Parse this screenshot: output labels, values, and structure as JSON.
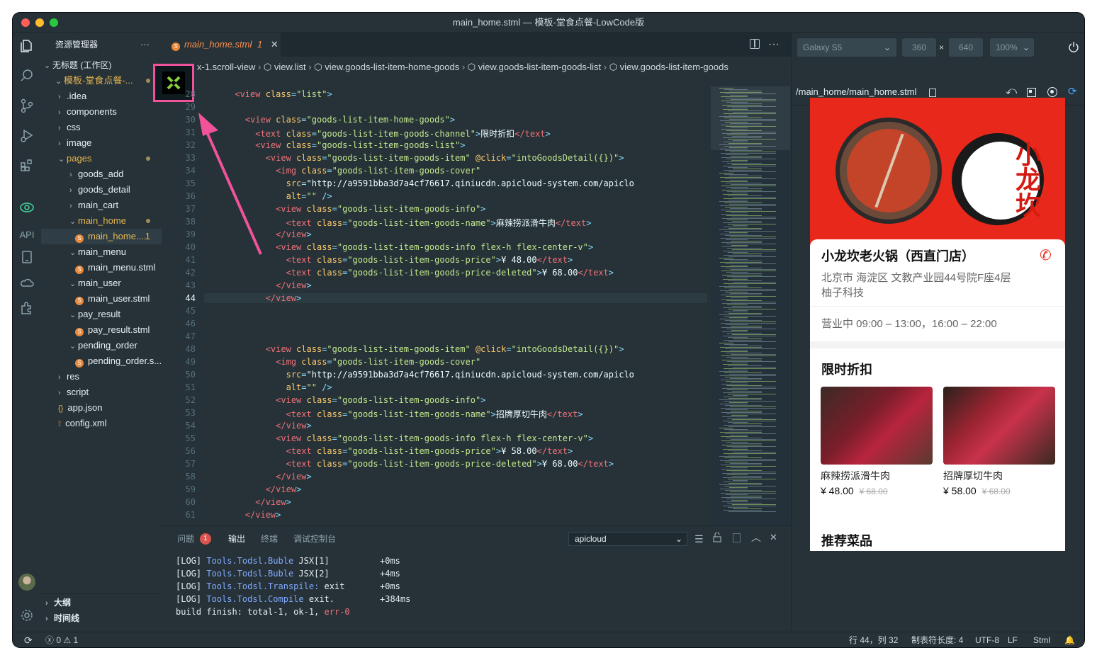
{
  "window": {
    "title": "main_home.stml — 模板-堂食点餐-LowCode版"
  },
  "activity": {
    "api_label": "API"
  },
  "sidebar": {
    "title": "资源管理器",
    "more": "···",
    "workspace": "无标题 (工作区)",
    "project": "模板-堂食点餐-...",
    "items": [
      {
        "label": ".idea"
      },
      {
        "label": "components"
      },
      {
        "label": "css"
      },
      {
        "label": "image"
      },
      {
        "label": "pages"
      },
      {
        "label": "goods_add"
      },
      {
        "label": "goods_detail"
      },
      {
        "label": "main_cart"
      },
      {
        "label": "main_home"
      },
      {
        "label": "main_home....",
        "badge": "1"
      },
      {
        "label": "main_menu"
      },
      {
        "label": "main_menu.stml"
      },
      {
        "label": "main_user"
      },
      {
        "label": "main_user.stml"
      },
      {
        "label": "pay_result"
      },
      {
        "label": "pay_result.stml"
      },
      {
        "label": "pending_order"
      },
      {
        "label": "pending_order.s..."
      },
      {
        "label": "res"
      },
      {
        "label": "script"
      },
      {
        "label": "app.json"
      },
      {
        "label": "config.xml"
      }
    ],
    "outline": "大纲",
    "timeline": "时间线"
  },
  "editor": {
    "tab_label": "main_home.stml",
    "tab_badge": "1",
    "breadcrumbs": [
      "x-1.scroll-view",
      "view.list",
      "view.goods-list-item-home-goods",
      "view.goods-list-item-goods-list",
      "view.goods-list-item-goods"
    ],
    "lines": [
      {
        "n": "28",
        "code": "      <view class=\"list\">"
      },
      {
        "n": "29",
        "code": ""
      },
      {
        "n": "30",
        "code": "        <view class=\"goods-list-item-home-goods\">"
      },
      {
        "n": "31",
        "code": "          <text class=\"goods-list-item-goods-channel\">限时折扣</text>"
      },
      {
        "n": "32",
        "code": "          <view class=\"goods-list-item-goods-list\">"
      },
      {
        "n": "33",
        "code": "            <view class=\"goods-list-item-goods-item\" @click=\"intoGoodsDetail({})\">"
      },
      {
        "n": "34",
        "code": "              <img class=\"goods-list-item-goods-cover\""
      },
      {
        "n": "35",
        "code": "                src=\"http://a9591bba3d7a4cf76617.qiniucdn.apicloud-system.com/apiclo"
      },
      {
        "n": "36",
        "code": "                alt=\"\" />"
      },
      {
        "n": "37",
        "code": "              <view class=\"goods-list-item-goods-info\">"
      },
      {
        "n": "38",
        "code": "                <text class=\"goods-list-item-goods-name\">麻辣捞派滑牛肉</text>"
      },
      {
        "n": "39",
        "code": "              </view>"
      },
      {
        "n": "40",
        "code": "              <view class=\"goods-list-item-goods-info flex-h flex-center-v\">"
      },
      {
        "n": "41",
        "code": "                <text class=\"goods-list-item-goods-price\">¥ 48.00</text>"
      },
      {
        "n": "42",
        "code": "                <text class=\"goods-list-item-goods-price-deleted\">¥ 68.00</text>"
      },
      {
        "n": "43",
        "code": "              </view>"
      },
      {
        "n": "44",
        "code": "            </view>"
      },
      {
        "n": "45",
        "code": ""
      },
      {
        "n": "46",
        "code": ""
      },
      {
        "n": "47",
        "code": ""
      },
      {
        "n": "48",
        "code": "            <view class=\"goods-list-item-goods-item\" @click=\"intoGoodsDetail({})\">"
      },
      {
        "n": "49",
        "code": "              <img class=\"goods-list-item-goods-cover\""
      },
      {
        "n": "50",
        "code": "                src=\"http://a9591bba3d7a4cf76617.qiniucdn.apicloud-system.com/apiclo"
      },
      {
        "n": "51",
        "code": "                alt=\"\" />"
      },
      {
        "n": "52",
        "code": "              <view class=\"goods-list-item-goods-info\">"
      },
      {
        "n": "53",
        "code": "                <text class=\"goods-list-item-goods-name\">招牌厚切牛肉</text>"
      },
      {
        "n": "54",
        "code": "              </view>"
      },
      {
        "n": "55",
        "code": "              <view class=\"goods-list-item-goods-info flex-h flex-center-v\">"
      },
      {
        "n": "56",
        "code": "                <text class=\"goods-list-item-goods-price\">¥ 58.00</text>"
      },
      {
        "n": "57",
        "code": "                <text class=\"goods-list-item-goods-price-deleted\">¥ 68.00</text>"
      },
      {
        "n": "58",
        "code": "              </view>"
      },
      {
        "n": "59",
        "code": "            </view>"
      },
      {
        "n": "60",
        "code": "          </view>"
      },
      {
        "n": "61",
        "code": "        </view>"
      }
    ]
  },
  "panel": {
    "tabs": [
      "问题",
      "输出",
      "终端",
      "调试控制台"
    ],
    "problems_count": "1",
    "channel": "apicloud",
    "log": [
      {
        "tag": "[LOG]",
        "src": "Tools.Todsl.Buble",
        "msg": "JSX[1]",
        "time": "+0ms"
      },
      {
        "tag": "[LOG]",
        "src": "Tools.Todsl.Buble",
        "msg": "JSX[2]",
        "time": "+4ms"
      },
      {
        "tag": "[LOG]",
        "src": "Tools.Todsl.Transpile:",
        "msg": "exit",
        "time": "+0ms"
      },
      {
        "tag": "[LOG]",
        "src": "Tools.Todsl.Compile",
        "msg": "exit.",
        "time": "+384ms"
      }
    ],
    "build": "build finish: total-1, ok-1, err-0"
  },
  "preview": {
    "device": "Galaxy S5",
    "width": "360",
    "times": "×",
    "height": "640",
    "zoom": "100%",
    "path": "/main_home/main_home.stml",
    "banner_title": "小龙坎",
    "store_name": "小龙坎老火锅（西直门店）",
    "address": "北京市 海淀区 文教产业园44号院F座4层 柚子科技",
    "hours": "营业中 09:00 – 13:00，16:00 – 22:00",
    "section_title": "限时折扣",
    "goods": [
      {
        "name": "麻辣捞派滑牛肉",
        "price": "¥ 48.00",
        "old": "¥ 68.00"
      },
      {
        "name": "招牌厚切牛肉",
        "price": "¥ 58.00",
        "old": "¥ 68.00"
      }
    ],
    "section2_title": "推荐菜品"
  },
  "status": {
    "errors": "0",
    "warnings": "1",
    "position": "行 44，列 32",
    "tab_size": "制表符长度: 4",
    "encoding": "UTF-8",
    "eol": "LF",
    "lang": "Stml"
  },
  "colors": {
    "accent_pink": "#f0539a",
    "orange": "#e8893b",
    "red_banner": "#e8281a"
  }
}
